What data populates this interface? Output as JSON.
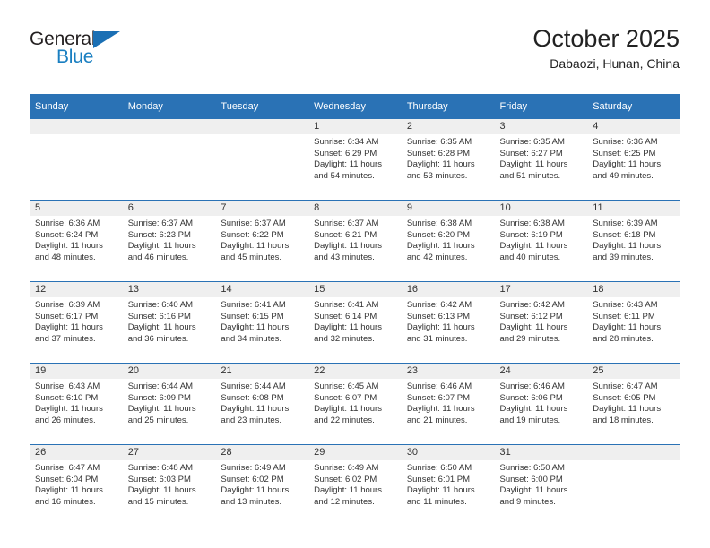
{
  "brand": {
    "name_top": "General",
    "name_bottom": "Blue",
    "accent_color": "#1a7fc1",
    "triangle_color": "#1a6fb4"
  },
  "header": {
    "title": "October 2025",
    "subtitle": "Dabaozi, Hunan, China"
  },
  "theme": {
    "header_blue": "#2a72b5",
    "date_strip_gray": "#efefef",
    "text_color": "#333333"
  },
  "weekday_headers": [
    "Sunday",
    "Monday",
    "Tuesday",
    "Wednesday",
    "Thursday",
    "Friday",
    "Saturday"
  ],
  "weeks": [
    [
      {
        "day": "",
        "sunrise": "",
        "sunset": "",
        "daylight_line1": "",
        "daylight_line2": ""
      },
      {
        "day": "",
        "sunrise": "",
        "sunset": "",
        "daylight_line1": "",
        "daylight_line2": ""
      },
      {
        "day": "",
        "sunrise": "",
        "sunset": "",
        "daylight_line1": "",
        "daylight_line2": ""
      },
      {
        "day": "1",
        "sunrise": "Sunrise: 6:34 AM",
        "sunset": "Sunset: 6:29 PM",
        "daylight_line1": "Daylight: 11 hours",
        "daylight_line2": "and 54 minutes."
      },
      {
        "day": "2",
        "sunrise": "Sunrise: 6:35 AM",
        "sunset": "Sunset: 6:28 PM",
        "daylight_line1": "Daylight: 11 hours",
        "daylight_line2": "and 53 minutes."
      },
      {
        "day": "3",
        "sunrise": "Sunrise: 6:35 AM",
        "sunset": "Sunset: 6:27 PM",
        "daylight_line1": "Daylight: 11 hours",
        "daylight_line2": "and 51 minutes."
      },
      {
        "day": "4",
        "sunrise": "Sunrise: 6:36 AM",
        "sunset": "Sunset: 6:25 PM",
        "daylight_line1": "Daylight: 11 hours",
        "daylight_line2": "and 49 minutes."
      }
    ],
    [
      {
        "day": "5",
        "sunrise": "Sunrise: 6:36 AM",
        "sunset": "Sunset: 6:24 PM",
        "daylight_line1": "Daylight: 11 hours",
        "daylight_line2": "and 48 minutes."
      },
      {
        "day": "6",
        "sunrise": "Sunrise: 6:37 AM",
        "sunset": "Sunset: 6:23 PM",
        "daylight_line1": "Daylight: 11 hours",
        "daylight_line2": "and 46 minutes."
      },
      {
        "day": "7",
        "sunrise": "Sunrise: 6:37 AM",
        "sunset": "Sunset: 6:22 PM",
        "daylight_line1": "Daylight: 11 hours",
        "daylight_line2": "and 45 minutes."
      },
      {
        "day": "8",
        "sunrise": "Sunrise: 6:37 AM",
        "sunset": "Sunset: 6:21 PM",
        "daylight_line1": "Daylight: 11 hours",
        "daylight_line2": "and 43 minutes."
      },
      {
        "day": "9",
        "sunrise": "Sunrise: 6:38 AM",
        "sunset": "Sunset: 6:20 PM",
        "daylight_line1": "Daylight: 11 hours",
        "daylight_line2": "and 42 minutes."
      },
      {
        "day": "10",
        "sunrise": "Sunrise: 6:38 AM",
        "sunset": "Sunset: 6:19 PM",
        "daylight_line1": "Daylight: 11 hours",
        "daylight_line2": "and 40 minutes."
      },
      {
        "day": "11",
        "sunrise": "Sunrise: 6:39 AM",
        "sunset": "Sunset: 6:18 PM",
        "daylight_line1": "Daylight: 11 hours",
        "daylight_line2": "and 39 minutes."
      }
    ],
    [
      {
        "day": "12",
        "sunrise": "Sunrise: 6:39 AM",
        "sunset": "Sunset: 6:17 PM",
        "daylight_line1": "Daylight: 11 hours",
        "daylight_line2": "and 37 minutes."
      },
      {
        "day": "13",
        "sunrise": "Sunrise: 6:40 AM",
        "sunset": "Sunset: 6:16 PM",
        "daylight_line1": "Daylight: 11 hours",
        "daylight_line2": "and 36 minutes."
      },
      {
        "day": "14",
        "sunrise": "Sunrise: 6:41 AM",
        "sunset": "Sunset: 6:15 PM",
        "daylight_line1": "Daylight: 11 hours",
        "daylight_line2": "and 34 minutes."
      },
      {
        "day": "15",
        "sunrise": "Sunrise: 6:41 AM",
        "sunset": "Sunset: 6:14 PM",
        "daylight_line1": "Daylight: 11 hours",
        "daylight_line2": "and 32 minutes."
      },
      {
        "day": "16",
        "sunrise": "Sunrise: 6:42 AM",
        "sunset": "Sunset: 6:13 PM",
        "daylight_line1": "Daylight: 11 hours",
        "daylight_line2": "and 31 minutes."
      },
      {
        "day": "17",
        "sunrise": "Sunrise: 6:42 AM",
        "sunset": "Sunset: 6:12 PM",
        "daylight_line1": "Daylight: 11 hours",
        "daylight_line2": "and 29 minutes."
      },
      {
        "day": "18",
        "sunrise": "Sunrise: 6:43 AM",
        "sunset": "Sunset: 6:11 PM",
        "daylight_line1": "Daylight: 11 hours",
        "daylight_line2": "and 28 minutes."
      }
    ],
    [
      {
        "day": "19",
        "sunrise": "Sunrise: 6:43 AM",
        "sunset": "Sunset: 6:10 PM",
        "daylight_line1": "Daylight: 11 hours",
        "daylight_line2": "and 26 minutes."
      },
      {
        "day": "20",
        "sunrise": "Sunrise: 6:44 AM",
        "sunset": "Sunset: 6:09 PM",
        "daylight_line1": "Daylight: 11 hours",
        "daylight_line2": "and 25 minutes."
      },
      {
        "day": "21",
        "sunrise": "Sunrise: 6:44 AM",
        "sunset": "Sunset: 6:08 PM",
        "daylight_line1": "Daylight: 11 hours",
        "daylight_line2": "and 23 minutes."
      },
      {
        "day": "22",
        "sunrise": "Sunrise: 6:45 AM",
        "sunset": "Sunset: 6:07 PM",
        "daylight_line1": "Daylight: 11 hours",
        "daylight_line2": "and 22 minutes."
      },
      {
        "day": "23",
        "sunrise": "Sunrise: 6:46 AM",
        "sunset": "Sunset: 6:07 PM",
        "daylight_line1": "Daylight: 11 hours",
        "daylight_line2": "and 21 minutes."
      },
      {
        "day": "24",
        "sunrise": "Sunrise: 6:46 AM",
        "sunset": "Sunset: 6:06 PM",
        "daylight_line1": "Daylight: 11 hours",
        "daylight_line2": "and 19 minutes."
      },
      {
        "day": "25",
        "sunrise": "Sunrise: 6:47 AM",
        "sunset": "Sunset: 6:05 PM",
        "daylight_line1": "Daylight: 11 hours",
        "daylight_line2": "and 18 minutes."
      }
    ],
    [
      {
        "day": "26",
        "sunrise": "Sunrise: 6:47 AM",
        "sunset": "Sunset: 6:04 PM",
        "daylight_line1": "Daylight: 11 hours",
        "daylight_line2": "and 16 minutes."
      },
      {
        "day": "27",
        "sunrise": "Sunrise: 6:48 AM",
        "sunset": "Sunset: 6:03 PM",
        "daylight_line1": "Daylight: 11 hours",
        "daylight_line2": "and 15 minutes."
      },
      {
        "day": "28",
        "sunrise": "Sunrise: 6:49 AM",
        "sunset": "Sunset: 6:02 PM",
        "daylight_line1": "Daylight: 11 hours",
        "daylight_line2": "and 13 minutes."
      },
      {
        "day": "29",
        "sunrise": "Sunrise: 6:49 AM",
        "sunset": "Sunset: 6:02 PM",
        "daylight_line1": "Daylight: 11 hours",
        "daylight_line2": "and 12 minutes."
      },
      {
        "day": "30",
        "sunrise": "Sunrise: 6:50 AM",
        "sunset": "Sunset: 6:01 PM",
        "daylight_line1": "Daylight: 11 hours",
        "daylight_line2": "and 11 minutes."
      },
      {
        "day": "31",
        "sunrise": "Sunrise: 6:50 AM",
        "sunset": "Sunset: 6:00 PM",
        "daylight_line1": "Daylight: 11 hours",
        "daylight_line2": "and 9 minutes."
      },
      {
        "day": "",
        "sunrise": "",
        "sunset": "",
        "daylight_line1": "",
        "daylight_line2": ""
      }
    ]
  ]
}
